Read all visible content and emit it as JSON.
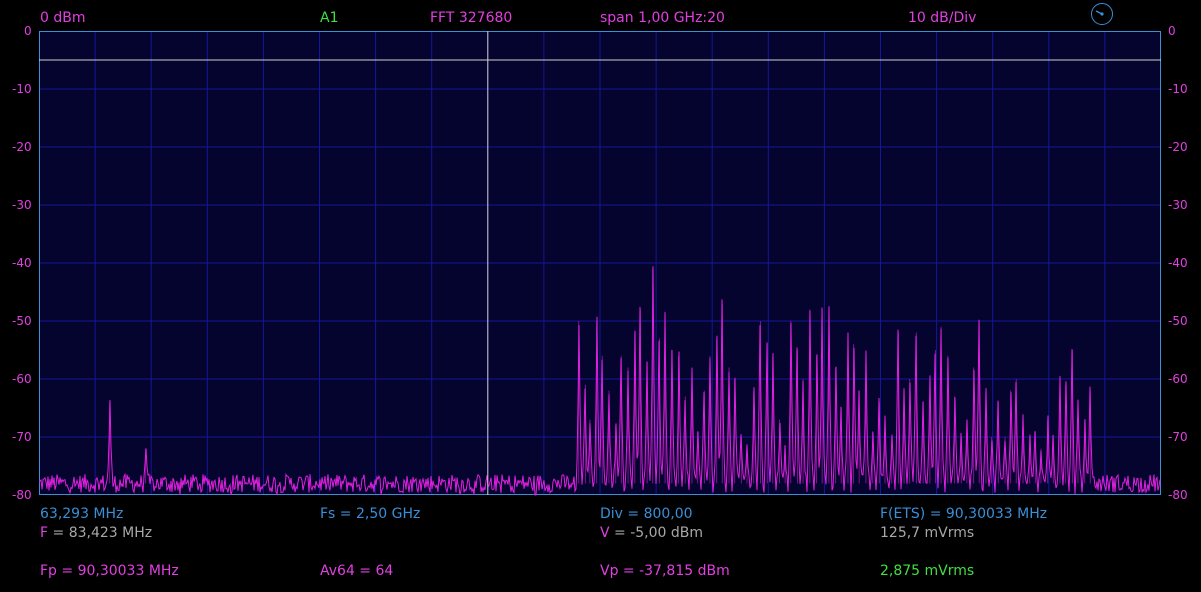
{
  "header": {
    "ref_level": "0 dBm",
    "channel": "A1",
    "fft": "FFT  327680",
    "span": "span 1,00 GHz:20",
    "scale": "10 dB/Div"
  },
  "colors": {
    "background": "#000000",
    "plot_bg": "#04042e",
    "grid": "#16169a",
    "frame": "#3a8fd8",
    "trace": "#e020e0",
    "text_magenta": "#e040e0",
    "text_green": "#40e040",
    "text_blue": "#3a8fd8",
    "text_gray": "#a8a8a8"
  },
  "icons": {
    "knob": "dial-knob-icon"
  },
  "y_ticks": [
    "0",
    "-10",
    "-20",
    "-30",
    "-40",
    "-50",
    "-60",
    "-70",
    "-80"
  ],
  "readouts": {
    "cursor_freq": "63,293 MHz",
    "fs": "Fs = 2,50 GHz",
    "div": "Div = 800,00",
    "f_ets": "F(ETS) = 90,30033 MHz",
    "f_label": "F",
    "f_value": " = 83,423 MHz",
    "v_label": "V",
    "v_value": " = -5,00 dBm",
    "mvrms1": "125,7 mVrms",
    "fp": "Fp = 90,30033 MHz",
    "av": "Av64 = 64",
    "vp": "Vp = -37,815 dBm",
    "mvrms2": "2,875 mVrms"
  },
  "chart_data": {
    "type": "line",
    "y_axis": {
      "range": [
        -80,
        0
      ],
      "unit": "dBm",
      "ticks": [
        0,
        -10,
        -20,
        -30,
        -40,
        -50,
        -60,
        -70,
        -80
      ]
    },
    "x_divisions": 20,
    "grid": true,
    "noise_floor_dbm": -78,
    "cursors": {
      "horizontal_dbm": -5,
      "vertical_fraction": 0.4
    },
    "peaks": [
      {
        "x": 0.063,
        "y": -64
      },
      {
        "x": 0.095,
        "y": -72
      },
      {
        "x": 0.481,
        "y": -50
      },
      {
        "x": 0.487,
        "y": -61
      },
      {
        "x": 0.491,
        "y": -67
      },
      {
        "x": 0.497,
        "y": -50
      },
      {
        "x": 0.502,
        "y": -56
      },
      {
        "x": 0.508,
        "y": -62
      },
      {
        "x": 0.514,
        "y": -68
      },
      {
        "x": 0.519,
        "y": -56
      },
      {
        "x": 0.525,
        "y": -58
      },
      {
        "x": 0.531,
        "y": -52
      },
      {
        "x": 0.536,
        "y": -48
      },
      {
        "x": 0.542,
        "y": -57
      },
      {
        "x": 0.547,
        "y": -41
      },
      {
        "x": 0.553,
        "y": -53
      },
      {
        "x": 0.558,
        "y": -49
      },
      {
        "x": 0.564,
        "y": -55
      },
      {
        "x": 0.57,
        "y": -56
      },
      {
        "x": 0.576,
        "y": -63
      },
      {
        "x": 0.582,
        "y": -58
      },
      {
        "x": 0.587,
        "y": -69
      },
      {
        "x": 0.593,
        "y": -62
      },
      {
        "x": 0.598,
        "y": -56
      },
      {
        "x": 0.604,
        "y": -53
      },
      {
        "x": 0.609,
        "y": -47
      },
      {
        "x": 0.615,
        "y": -58
      },
      {
        "x": 0.62,
        "y": -60
      },
      {
        "x": 0.626,
        "y": -70
      },
      {
        "x": 0.631,
        "y": -72
      },
      {
        "x": 0.637,
        "y": -62
      },
      {
        "x": 0.643,
        "y": -50
      },
      {
        "x": 0.649,
        "y": -54
      },
      {
        "x": 0.654,
        "y": -56
      },
      {
        "x": 0.66,
        "y": -67
      },
      {
        "x": 0.665,
        "y": -72
      },
      {
        "x": 0.67,
        "y": -50
      },
      {
        "x": 0.676,
        "y": -55
      },
      {
        "x": 0.681,
        "y": -60
      },
      {
        "x": 0.687,
        "y": -48
      },
      {
        "x": 0.693,
        "y": -56
      },
      {
        "x": 0.698,
        "y": -48
      },
      {
        "x": 0.704,
        "y": -48
      },
      {
        "x": 0.71,
        "y": -58
      },
      {
        "x": 0.715,
        "y": -65
      },
      {
        "x": 0.721,
        "y": -52
      },
      {
        "x": 0.726,
        "y": -54
      },
      {
        "x": 0.731,
        "y": -62
      },
      {
        "x": 0.737,
        "y": -55
      },
      {
        "x": 0.743,
        "y": -69
      },
      {
        "x": 0.749,
        "y": -64
      },
      {
        "x": 0.754,
        "y": -67
      },
      {
        "x": 0.76,
        "y": -70
      },
      {
        "x": 0.766,
        "y": -52
      },
      {
        "x": 0.771,
        "y": -62
      },
      {
        "x": 0.776,
        "y": -60
      },
      {
        "x": 0.782,
        "y": -52
      },
      {
        "x": 0.788,
        "y": -64
      },
      {
        "x": 0.794,
        "y": -60
      },
      {
        "x": 0.799,
        "y": -55
      },
      {
        "x": 0.804,
        "y": -51
      },
      {
        "x": 0.81,
        "y": -56
      },
      {
        "x": 0.816,
        "y": -63
      },
      {
        "x": 0.822,
        "y": -70
      },
      {
        "x": 0.827,
        "y": -67
      },
      {
        "x": 0.833,
        "y": -58
      },
      {
        "x": 0.838,
        "y": -50
      },
      {
        "x": 0.844,
        "y": -62
      },
      {
        "x": 0.849,
        "y": -70
      },
      {
        "x": 0.855,
        "y": -64
      },
      {
        "x": 0.861,
        "y": -70
      },
      {
        "x": 0.866,
        "y": -62
      },
      {
        "x": 0.871,
        "y": -60
      },
      {
        "x": 0.877,
        "y": -66
      },
      {
        "x": 0.883,
        "y": -70
      },
      {
        "x": 0.888,
        "y": -69
      },
      {
        "x": 0.893,
        "y": -72
      },
      {
        "x": 0.899,
        "y": -67
      },
      {
        "x": 0.904,
        "y": -70
      },
      {
        "x": 0.91,
        "y": -60
      },
      {
        "x": 0.915,
        "y": -61
      },
      {
        "x": 0.921,
        "y": -55
      },
      {
        "x": 0.926,
        "y": -64
      },
      {
        "x": 0.932,
        "y": -67
      },
      {
        "x": 0.937,
        "y": -62
      }
    ]
  }
}
